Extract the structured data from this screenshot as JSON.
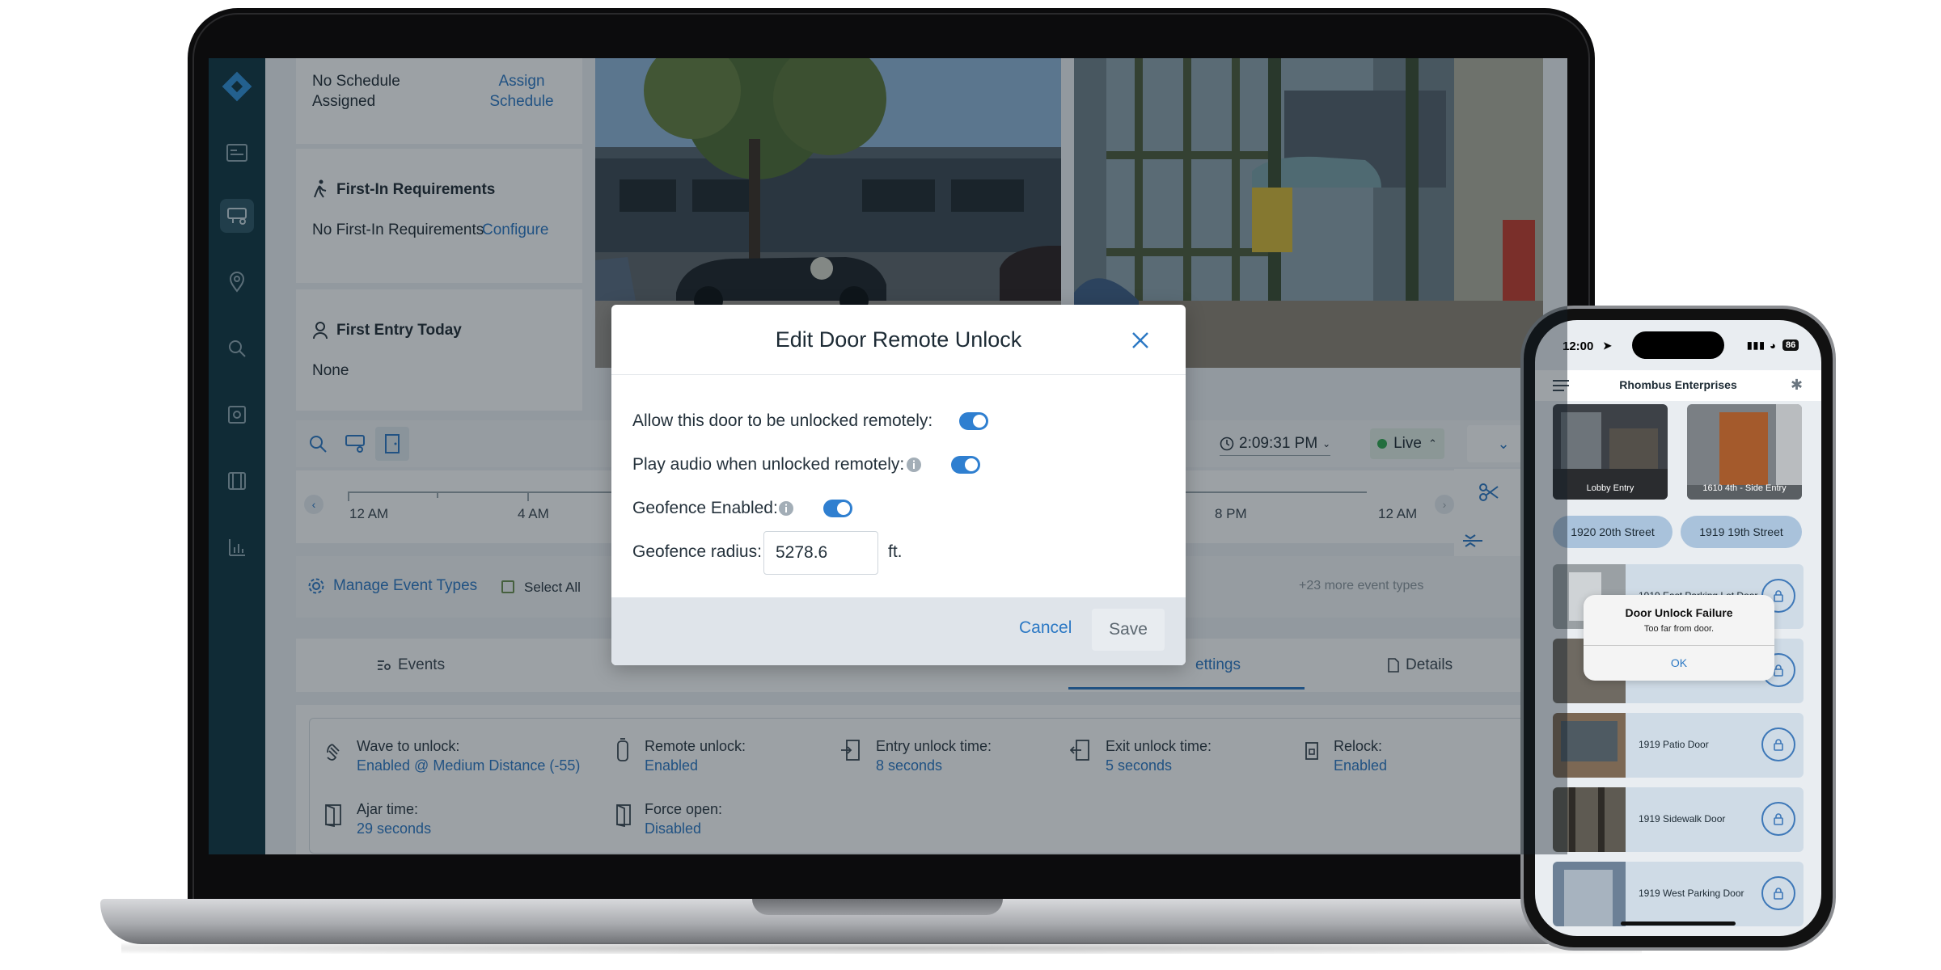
{
  "left_panel": {
    "schedule_status": "No Schedule Assigned",
    "assign_schedule": "Assign Schedule",
    "first_in_title": "First-In Requirements",
    "first_in_status": "No First-In Requirements",
    "first_in_configure": "Configure",
    "first_entry_title": "First Entry Today",
    "first_entry_value": "None"
  },
  "toolbar": {
    "time": "2:09:31 PM",
    "live_label": "Live"
  },
  "timeline": {
    "ticks": [
      "12 AM",
      "4 AM",
      "8 PM",
      "12 AM"
    ]
  },
  "event_bar": {
    "manage_label": "Manage Event Types",
    "select_all": "Select All",
    "more_types": "+23 more event types"
  },
  "tabs": {
    "events": "Events",
    "settings": "ettings",
    "details": "Details"
  },
  "settings": [
    {
      "label": "Wave to unlock:",
      "value": "Enabled @ Medium Distance (-55)"
    },
    {
      "label": "Remote unlock:",
      "value": "Enabled"
    },
    {
      "label": "Entry unlock time:",
      "value": "8 seconds"
    },
    {
      "label": "Exit unlock time:",
      "value": "5 seconds"
    },
    {
      "label": "Relock:",
      "value": "Enabled"
    },
    {
      "label": "Ajar time:",
      "value": "29 seconds"
    },
    {
      "label": "Force open:",
      "value": "Disabled"
    }
  ],
  "modal": {
    "title": "Edit Door Remote Unlock",
    "allow_remote": "Allow this door to be unlocked remotely:",
    "play_audio": "Play audio when unlocked remotely:",
    "geofence_enabled": "Geofence Enabled:",
    "geofence_radius_label": "Geofence radius:",
    "geofence_radius_value": "5278.6",
    "unit": "ft.",
    "cancel": "Cancel",
    "save": "Save"
  },
  "phone": {
    "time": "12:00",
    "battery": "86",
    "title": "Rhombus Enterprises",
    "thumbs": [
      "Lobby Entry",
      "1610 4th - Side Entry"
    ],
    "chips": [
      "1920 20th Street",
      "1919 19th Street"
    ],
    "doors": [
      "1919 East Parking Lot Door",
      "1919 Patio Door",
      "1919 Sidewalk Door",
      "1919 West Parking Door"
    ],
    "alert": {
      "title": "Door Unlock Failure",
      "message": "Too far from door.",
      "ok": "OK"
    }
  },
  "colors": {
    "accent": "#2f7fd0",
    "sidebar": "#0f3441",
    "link": "#2b78c4"
  }
}
